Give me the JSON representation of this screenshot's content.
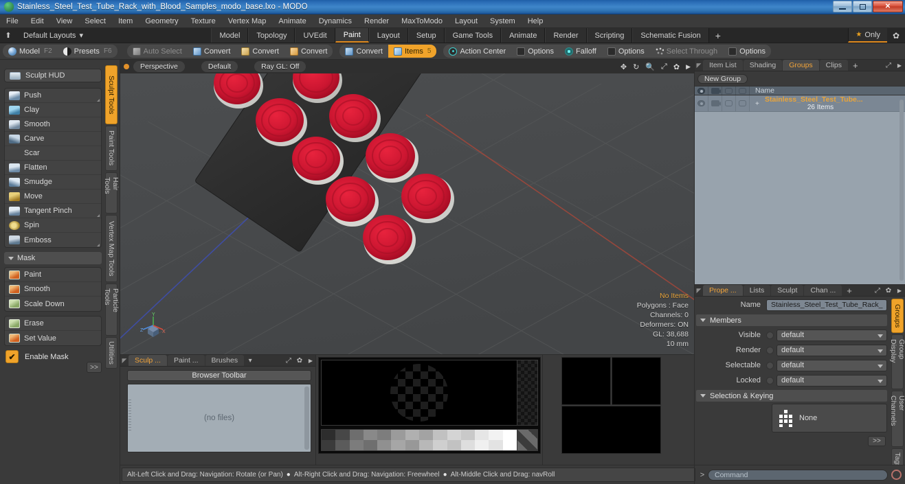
{
  "window": {
    "title": "Stainless_Steel_Test_Tube_Rack_with_Blood_Samples_modo_base.lxo - MODO",
    "app_icon": "modo-logo-icon",
    "minimize": "–",
    "maximize": "❐",
    "close": "✕"
  },
  "menu": {
    "items": [
      "File",
      "Edit",
      "View",
      "Select",
      "Item",
      "Geometry",
      "Texture",
      "Vertex Map",
      "Animate",
      "Dynamics",
      "Render",
      "MaxToModo",
      "Layout",
      "System",
      "Help"
    ]
  },
  "layout_bar": {
    "home_icon": "home-icon",
    "dropdown_label": "Default Layouts",
    "dropdown_caret": "▾",
    "tabs": [
      {
        "label": "Model",
        "active": false
      },
      {
        "label": "Topology",
        "active": false
      },
      {
        "label": "UVEdit",
        "active": false
      },
      {
        "label": "Paint",
        "active": true
      },
      {
        "label": "Layout",
        "active": false
      },
      {
        "label": "Setup",
        "active": false
      },
      {
        "label": "Game Tools",
        "active": false
      },
      {
        "label": "Animate",
        "active": false
      },
      {
        "label": "Render",
        "active": false
      },
      {
        "label": "Scripting",
        "active": false
      },
      {
        "label": "Schematic Fusion",
        "active": false
      }
    ],
    "add_tab": "+",
    "only_label": "Only",
    "only_star": "★",
    "gear": "✿"
  },
  "mode_bar": {
    "group_left": [
      {
        "label": "Model",
        "hotkey": "F2",
        "icon": "sphere-icon",
        "state": "normal"
      },
      {
        "label": "Presets",
        "hotkey": "F6",
        "icon": "half-sphere-icon",
        "state": "normal"
      }
    ],
    "group_mid": [
      {
        "label": "Auto Select",
        "icon": "cube-gray-icon",
        "state": "disabled"
      },
      {
        "label": "Convert",
        "icon": "cube-blue-icon",
        "state": "normal"
      },
      {
        "label": "Convert",
        "icon": "cube-yellow-icon",
        "state": "normal"
      },
      {
        "label": "Convert",
        "icon": "cube-orange-icon",
        "state": "normal"
      }
    ],
    "group_right": [
      {
        "label": "Convert",
        "icon": "cube-blue-icon",
        "state": "normal"
      },
      {
        "label": "Items",
        "hotkey": "5",
        "icon": "cube-sel-icon",
        "state": "selected"
      }
    ],
    "group_far": [
      {
        "label": "Action Center",
        "icon": "target-icon",
        "state": "normal"
      },
      {
        "label": "Options",
        "icon": "checkbox-icon",
        "state": "normal"
      },
      {
        "label": "Falloff",
        "icon": "falloff-icon",
        "state": "normal"
      },
      {
        "label": "Options",
        "icon": "checkbox-icon",
        "state": "normal"
      },
      {
        "label": "Select Through",
        "icon": "dots-icon",
        "state": "disabled"
      },
      {
        "label": "Options",
        "icon": "checkbox-icon",
        "state": "normal"
      }
    ]
  },
  "sidebar": {
    "vertical_tabs": [
      {
        "label": "Sculpt Tools",
        "active": true
      },
      {
        "label": "Paint Tools",
        "active": false
      },
      {
        "label": "Hair Tools",
        "active": false
      },
      {
        "label": "Vertex Map Tools",
        "active": false
      },
      {
        "label": "Particle Tools",
        "active": false
      },
      {
        "label": "Utilities",
        "active": false
      }
    ],
    "hud": {
      "label": "Sculpt HUD",
      "icon": "hud-icon"
    },
    "sculpt_tools": [
      {
        "label": "Push",
        "icon": "push-brush-icon",
        "corner": true
      },
      {
        "label": "Clay",
        "icon": "clay-brush-icon",
        "corner": false
      },
      {
        "label": "Smooth",
        "icon": "smooth-brush-icon",
        "corner": false
      },
      {
        "label": "Carve",
        "icon": "carve-brush-icon",
        "corner": false
      },
      {
        "label": "Scar",
        "icon": "scar-brush-icon",
        "corner": false
      },
      {
        "label": "Flatten",
        "icon": "flatten-brush-icon",
        "corner": false
      },
      {
        "label": "Smudge",
        "icon": "smudge-brush-icon",
        "corner": false
      },
      {
        "label": "Move",
        "icon": "move-brush-icon",
        "corner": false
      },
      {
        "label": "Tangent Pinch",
        "icon": "pinch-brush-icon",
        "corner": true
      },
      {
        "label": "Spin",
        "icon": "spin-brush-icon",
        "corner": false
      },
      {
        "label": "Emboss",
        "icon": "emboss-brush-icon",
        "corner": true
      }
    ],
    "mask_section": {
      "label": "Mask",
      "caret": "▾"
    },
    "mask_tools": [
      {
        "label": "Paint",
        "icon": "mask-paint-icon"
      },
      {
        "label": "Smooth",
        "icon": "mask-smooth-icon"
      },
      {
        "label": "Scale Down",
        "icon": "mask-scale-icon"
      }
    ],
    "mask_tools2": [
      {
        "label": "Erase",
        "icon": "mask-erase-icon"
      },
      {
        "label": "Set Value",
        "icon": "mask-setvalue-icon"
      }
    ],
    "enable_mask": {
      "label": "Enable Mask",
      "checked": true,
      "check_glyph": "✔"
    },
    "expand_button": ">>"
  },
  "viewport": {
    "pills": [
      {
        "label": "Perspective",
        "icon": "view-dot-icon"
      },
      {
        "label": "Default",
        "icon": ""
      },
      {
        "label": "Ray GL: Off",
        "icon": ""
      }
    ],
    "header_icons": [
      "move-icon",
      "rotate-icon",
      "zoom-icon",
      "fit-icon",
      "gear-icon",
      "chevron-right-icon"
    ],
    "info": {
      "selection": "No Items",
      "polygons": "Polygons : Face",
      "channels": "Channels: 0",
      "deformers": "Deformers: ON",
      "gl": "GL: 38,688",
      "scale": "10 mm"
    },
    "axis_labels": {
      "x": "X",
      "y": "Y",
      "z": "Z"
    }
  },
  "browser_panel": {
    "tabs": [
      {
        "label": "Sculp ...",
        "active": true
      },
      {
        "label": "Paint ...",
        "active": false
      },
      {
        "label": "Brushes",
        "active": false
      }
    ],
    "caret": "▾",
    "tab_icons": [
      "expand-icon",
      "gear-icon",
      "chevron-right-icon"
    ],
    "toolbar_label": "Browser Toolbar",
    "empty_text": "(no files)"
  },
  "groups_panel": {
    "tabs": [
      {
        "label": "Item List",
        "active": false
      },
      {
        "label": "Shading",
        "active": false
      },
      {
        "label": "Groups",
        "active": true
      },
      {
        "label": "Clips",
        "active": false
      }
    ],
    "add_tab": "+",
    "tab_icons": [
      "expand-icon",
      "chevron-right-icon"
    ],
    "new_group_label": "New Group",
    "columns": [
      "visible-icon",
      "render-icon",
      "select-icon",
      "lock-icon",
      "Name"
    ],
    "rows": [
      {
        "name": "Stainless_Steel_Test_Tube...",
        "count": "26 Items",
        "expand": "+",
        "icon": "group-icon"
      }
    ]
  },
  "props_panel": {
    "tabs": [
      {
        "label": "Prope ...",
        "active": true
      },
      {
        "label": "Lists",
        "active": false
      },
      {
        "label": "Sculpt",
        "active": false
      },
      {
        "label": "Chan ...",
        "active": false
      }
    ],
    "add_tab": "+",
    "tab_icons": [
      "expand-icon",
      "gear-icon",
      "chevron-right-icon"
    ],
    "name_label": "Name",
    "name_value": "Stainless_Steel_Test_Tube_Rack_",
    "members_section": "Members",
    "fields": [
      {
        "label": "Visible",
        "value": "default"
      },
      {
        "label": "Render",
        "value": "default"
      },
      {
        "label": "Selectable",
        "value": "default"
      },
      {
        "label": "Locked",
        "value": "default"
      }
    ],
    "selection_section": "Selection & Keying",
    "keying_value": "None",
    "expand_button": ">>",
    "vertical_tabs": [
      {
        "label": "Groups",
        "active": true
      },
      {
        "label": "Group Display",
        "active": false
      },
      {
        "label": "User Channels",
        "active": false
      },
      {
        "label": "Tags",
        "active": false
      }
    ]
  },
  "statusbar": {
    "hints": [
      "Alt-Left Click and Drag: Navigation: Rotate (or Pan)",
      "Alt-Right Click and Drag: Navigation: Freewheel",
      "Alt-Middle Click and Drag: navRoll"
    ],
    "bullet": "●",
    "command_prompt": ">",
    "command_placeholder": "Command"
  },
  "colors": {
    "accent": "#f0a32a",
    "panel_bg": "#3a3a3a",
    "title_blue": "#2f74b5",
    "list_blue": "#7b8794",
    "blood_red": "#c5142b"
  }
}
